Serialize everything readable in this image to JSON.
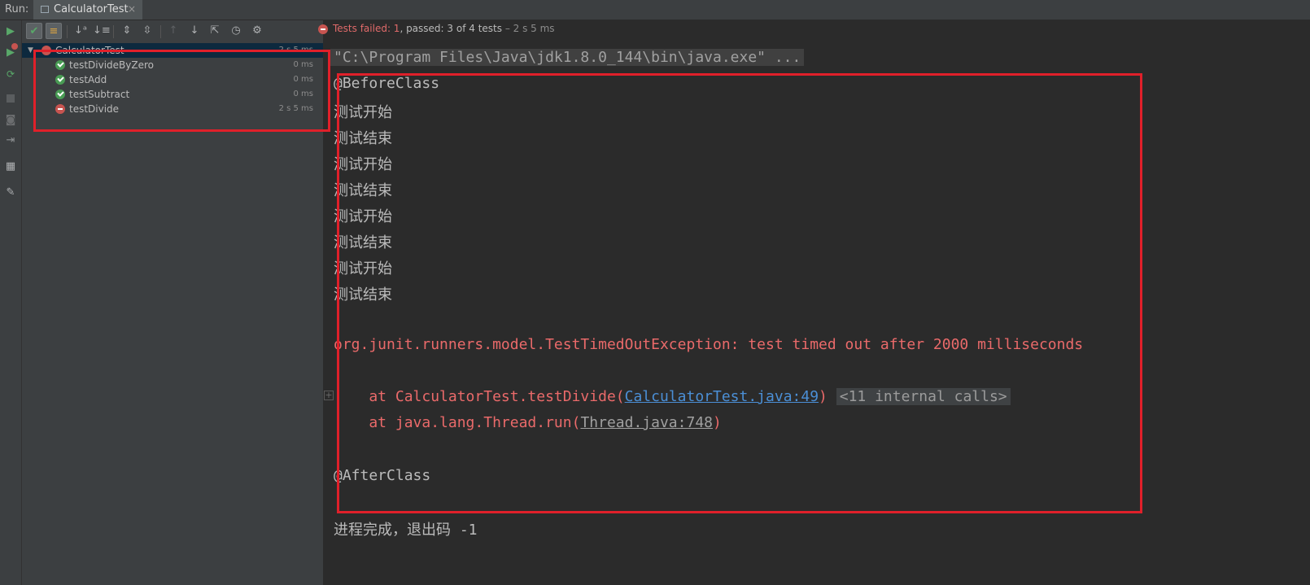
{
  "run_bar": {
    "label": "Run:",
    "tab_title": "CalculatorTest",
    "tab_close": "×"
  },
  "test_tree": {
    "root": {
      "name": "CalculatorTest",
      "time": "2 s 5 ms",
      "status": "failed"
    },
    "items": [
      {
        "name": "testDivideByZero",
        "time": "0 ms",
        "status": "passed"
      },
      {
        "name": "testAdd",
        "time": "0 ms",
        "status": "passed"
      },
      {
        "name": "testSubtract",
        "time": "0 ms",
        "status": "passed"
      },
      {
        "name": "testDivide",
        "time": "2 s 5 ms",
        "status": "failed"
      }
    ]
  },
  "status": {
    "failed_text": "Tests failed: 1",
    "passed_text": ", passed: 3",
    "rest_text": " of 4 tests",
    "duration_text": " – 2 s 5 ms"
  },
  "console": {
    "cmd": "\"C:\\Program Files\\Java\\jdk1.8.0_144\\bin\\java.exe\" ...",
    "before_class": "@BeforeClass",
    "lines": [
      "测试开始",
      "测试结束",
      "测试开始",
      "测试结束",
      "测试开始",
      "测试结束",
      "测试开始",
      "测试结束"
    ],
    "exception": "org.junit.runners.model.TestTimedOutException: test timed out after 2000 milliseconds",
    "trace1_prefix": "    at CalculatorTest.testDivide(",
    "trace1_link": "CalculatorTest.java:49",
    "trace1_suffix": ")",
    "trace1_fold": "<11 internal calls>",
    "trace2_prefix": "    at java.lang.Thread.run(",
    "trace2_link": "Thread.java:748",
    "trace2_suffix": ")",
    "after_class": "@AfterClass",
    "exit": "进程完成，退出码 -1"
  },
  "colors": {
    "pass": "#499c54",
    "fail": "#c75450",
    "annotation": "#e0202a",
    "error_text": "#ea6a6a",
    "link": "#4b8fd6"
  },
  "icons": {
    "left_toolbar": [
      "rerun-icon",
      "rerun-failed-icon",
      "toggle-auto-test-icon",
      "stop-icon",
      "camera-icon",
      "export-icon",
      "layout-icon",
      "pin-icon"
    ],
    "tree_toolbar": [
      "show-passed-icon",
      "show-ignored-icon",
      "sort-alpha-icon",
      "sort-duration-icon",
      "expand-all-icon",
      "collapse-all-icon",
      "previous-failed-icon",
      "next-failed-icon",
      "export-results-icon",
      "history-icon",
      "settings-icon"
    ]
  }
}
